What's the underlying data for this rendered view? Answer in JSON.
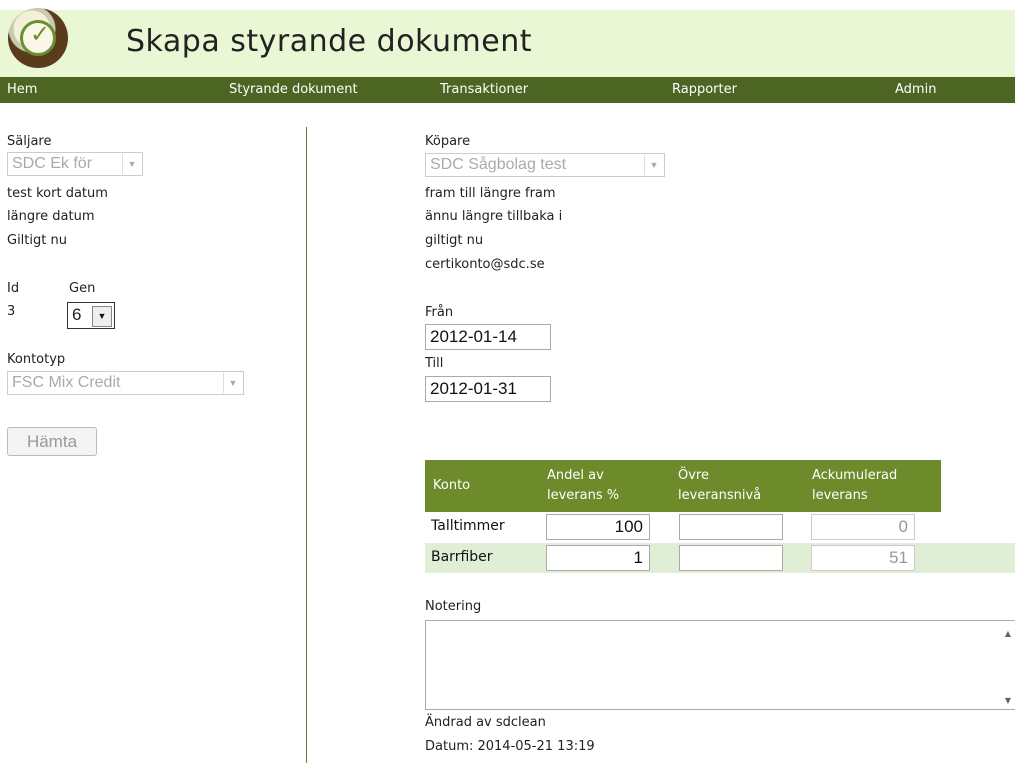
{
  "header": {
    "title": "Skapa styrande dokument"
  },
  "nav": [
    "Hem",
    "Styrande dokument",
    "Transaktioner",
    "Rapporter",
    "Admin"
  ],
  "seller": {
    "label": "Säljare",
    "selected": "SDC Ek för",
    "lines": [
      "test kort datum",
      "längre datum",
      "Giltigt nu"
    ],
    "id_label": "Id",
    "gen_label": "Gen",
    "id_value": "3",
    "gen_value": "6",
    "account_type_label": "Kontotyp",
    "account_type_value": "FSC Mix Credit",
    "fetch_button": "Hämta"
  },
  "buyer": {
    "label": "Köpare",
    "selected": "SDC Sågbolag test",
    "lines": [
      "fram till längre fram",
      "ännu längre tillbaka i",
      "giltigt nu",
      "certikonto@sdc.se"
    ],
    "from_label": "Från",
    "from_value": "2012-01-14",
    "to_label": "Till",
    "to_value": "2012-01-31"
  },
  "table": {
    "headers": [
      "Konto",
      "Andel av leverans %",
      "Övre leveransnivå",
      "Ackumulerad leverans"
    ],
    "rows": [
      {
        "account": "Talltimmer",
        "share": "100",
        "upper": "",
        "accumulated": "0"
      },
      {
        "account": "Barrfiber",
        "share": "1",
        "upper": "",
        "accumulated": "51"
      }
    ]
  },
  "note": {
    "label": "Notering",
    "value": ""
  },
  "footer": {
    "changed_by": "Ändrad av sdclean",
    "date": "Datum: 2014-05-21 13:19"
  },
  "colors": {
    "header_bg": "#e9f7d4",
    "nav_bg": "#4d6522",
    "table_head": "#6d8b2a",
    "row_alt": "#e1eed6"
  }
}
